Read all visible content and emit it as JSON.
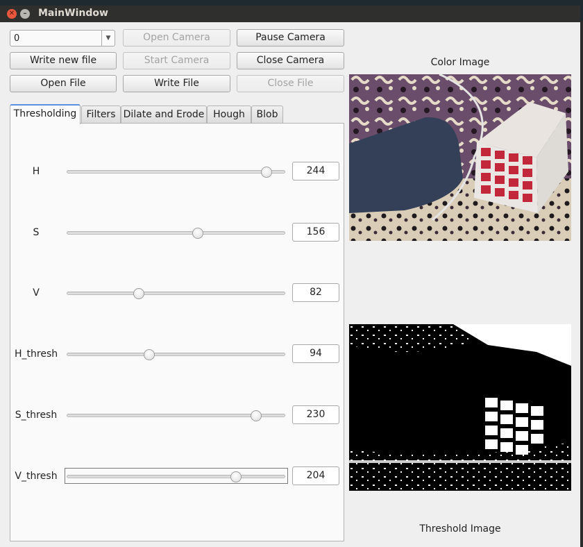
{
  "window": {
    "title": "MainWindow"
  },
  "controls": {
    "camera_index": "0",
    "buttons": [
      {
        "label": "Open Camera",
        "enabled": false
      },
      {
        "label": "Pause Camera",
        "enabled": true
      },
      {
        "label": "Write new file",
        "enabled": true
      },
      {
        "label": "Start Camera",
        "enabled": false
      },
      {
        "label": "Close Camera",
        "enabled": true
      },
      {
        "label": "Open File",
        "enabled": true
      },
      {
        "label": "Write File",
        "enabled": true
      },
      {
        "label": "Close File",
        "enabled": false
      }
    ]
  },
  "tabs": [
    {
      "label": "Thresholding",
      "active": true
    },
    {
      "label": "Filters",
      "active": false
    },
    {
      "label": "Dilate and Erode",
      "active": false
    },
    {
      "label": "Hough",
      "active": false
    },
    {
      "label": "Blob",
      "active": false
    }
  ],
  "sliders": [
    {
      "label": "H",
      "value": "244",
      "fraction": 0.935
    },
    {
      "label": "S",
      "value": "156",
      "fraction": 0.605
    },
    {
      "label": "V",
      "value": "82",
      "fraction": 0.32
    },
    {
      "label": "H_thresh",
      "value": "94",
      "fraction": 0.37
    },
    {
      "label": "S_thresh",
      "value": "230",
      "fraction": 0.885
    },
    {
      "label": "V_thresh",
      "value": "204",
      "fraction": 0.79
    }
  ],
  "images": {
    "color_caption": "Color Image",
    "threshold_caption": "Threshold Image"
  },
  "colors": {
    "titlebar": "#2f2f2e",
    "tab_accent": "#5a8ede",
    "close_button": "#e9573d"
  }
}
